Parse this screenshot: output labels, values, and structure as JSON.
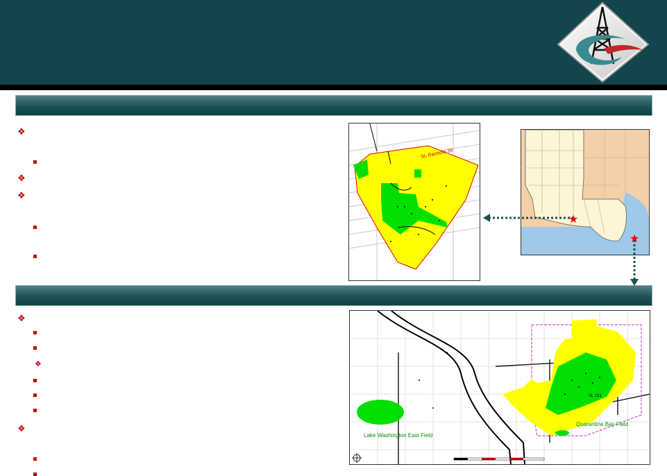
{
  "header": {
    "logo_icon": "derrick-logo-icon"
  },
  "colors": {
    "header": "#12454c",
    "bar": "#1b5257",
    "bullet": "#c00000",
    "field_yellow": "#ffff00",
    "field_green": "#00e000"
  },
  "map_bottom": {
    "labels": {
      "west_field": "Lake Washington East Field",
      "east_field": "Quarantine Bay Field",
      "lease_sl": "SL 191"
    }
  },
  "map_top": {
    "labels": {
      "lease": "SL Rarotola 39"
    }
  }
}
